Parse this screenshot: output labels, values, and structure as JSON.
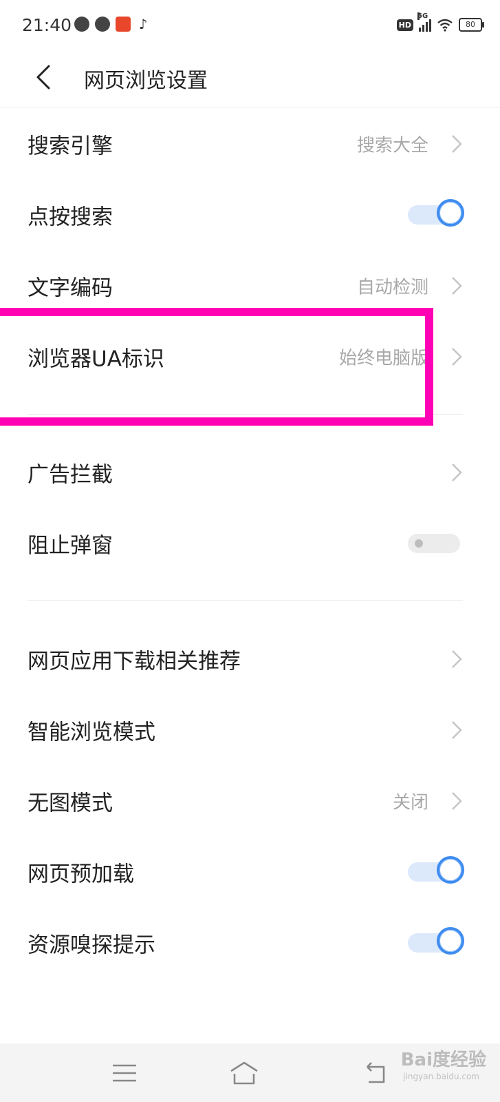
{
  "status_bar": {
    "time": "21:40",
    "signal_label": "5G",
    "hd_label": "HD",
    "battery": "80"
  },
  "header": {
    "title": "网页浏览设置",
    "back_icon": "chevron-left-icon"
  },
  "settings": [
    {
      "label": "搜索引擎",
      "value": "搜索大全",
      "control": "chevron"
    },
    {
      "label": "点按搜索",
      "value": "",
      "control": "toggle",
      "on": true
    },
    {
      "label": "文字编码",
      "value": "自动检测",
      "control": "chevron"
    },
    {
      "label": "浏览器UA标识",
      "value": "始终电脑版",
      "control": "chevron"
    },
    {
      "label": "广告拦截",
      "value": "",
      "control": "chevron"
    },
    {
      "label": "阻止弹窗",
      "value": "",
      "control": "toggle",
      "on": false
    },
    {
      "label": "网页应用下载相关推荐",
      "value": "",
      "control": "chevron"
    },
    {
      "label": "智能浏览模式",
      "value": "",
      "control": "chevron"
    },
    {
      "label": "无图模式",
      "value": "关闭",
      "control": "chevron"
    },
    {
      "label": "网页预加载",
      "value": "",
      "control": "toggle",
      "on": true
    },
    {
      "label": "资源嗅探提示",
      "value": "",
      "control": "toggle",
      "on": true
    }
  ],
  "highlight": {
    "color": "#ff00b4"
  },
  "colors": {
    "accent": "#3f8cf0",
    "value_text": "#a8a8a8"
  },
  "nav_bar": {
    "menu_icon": "menu-icon",
    "home_icon": "home-icon",
    "back_icon": "back-icon"
  },
  "watermark": {
    "brand": "Bai度经验",
    "sub": "jingyan.baidu.com"
  }
}
